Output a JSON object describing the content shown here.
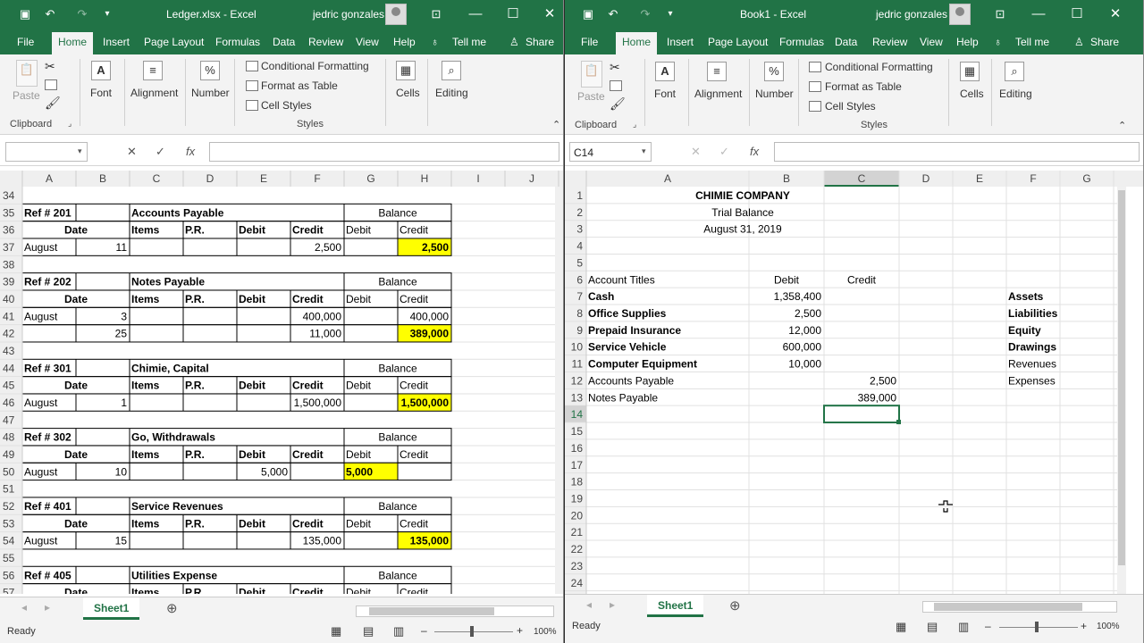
{
  "left": {
    "title": "Ledger.xlsx  -  Excel",
    "user": "jedric gonzales",
    "tabs": [
      "File",
      "Home",
      "Insert",
      "Page Layout",
      "Formulas",
      "Data",
      "Review",
      "View",
      "Help"
    ],
    "tell_me": "Tell me",
    "share": "Share",
    "ribbon": {
      "paste": "Paste",
      "clipboard": "Clipboard",
      "font": "Font",
      "alignment": "Alignment",
      "number": "Number",
      "cond_format": "Conditional Formatting",
      "format_table": "Format as Table",
      "cell_styles": "Cell Styles",
      "styles": "Styles",
      "cells": "Cells",
      "editing": "Editing"
    },
    "name_box": "",
    "columns": [
      "A",
      "B",
      "C",
      "D",
      "E",
      "F",
      "G",
      "H",
      "I",
      "J"
    ],
    "rows": [
      {
        "n": "34",
        "c": {}
      },
      {
        "n": "35",
        "c": {
          "A": "Ref # 201",
          "C": "Accounts Payable",
          "GH": "Balance"
        }
      },
      {
        "n": "36",
        "c": {
          "AB": "Date",
          "C": "Items",
          "D": "P.R.",
          "E": "Debit",
          "F": "Credit",
          "G": "Debit",
          "H": "Credit"
        }
      },
      {
        "n": "37",
        "c": {
          "A": "August",
          "B": "11",
          "F": "2,500",
          "H": "2,500"
        }
      },
      {
        "n": "38",
        "c": {}
      },
      {
        "n": "39",
        "c": {
          "A": "Ref # 202",
          "C": "Notes Payable",
          "GH": "Balance"
        }
      },
      {
        "n": "40",
        "c": {
          "AB": "Date",
          "C": "Items",
          "D": "P.R.",
          "E": "Debit",
          "F": "Credit",
          "G": "Debit",
          "H": "Credit"
        }
      },
      {
        "n": "41",
        "c": {
          "A": "August",
          "B": "3",
          "F": "400,000",
          "H": "400,000"
        }
      },
      {
        "n": "42",
        "c": {
          "B": "25",
          "F": "11,000",
          "H": "389,000"
        }
      },
      {
        "n": "43",
        "c": {}
      },
      {
        "n": "44",
        "c": {
          "A": "Ref # 301",
          "C": "Chimie, Capital",
          "GH": "Balance"
        }
      },
      {
        "n": "45",
        "c": {
          "AB": "Date",
          "C": "Items",
          "D": "P.R.",
          "E": "Debit",
          "F": "Credit",
          "G": "Debit",
          "H": "Credit"
        }
      },
      {
        "n": "46",
        "c": {
          "A": "August",
          "B": "1",
          "F": "1,500,000",
          "H": "1,500,000"
        }
      },
      {
        "n": "47",
        "c": {}
      },
      {
        "n": "48",
        "c": {
          "A": "Ref # 302",
          "C": "Go, Withdrawals",
          "GH": "Balance"
        }
      },
      {
        "n": "49",
        "c": {
          "AB": "Date",
          "C": "Items",
          "D": "P.R.",
          "E": "Debit",
          "F": "Credit",
          "G": "Debit",
          "H": "Credit"
        }
      },
      {
        "n": "50",
        "c": {
          "A": "August",
          "B": "10",
          "E": "5,000",
          "G": "5,000"
        }
      },
      {
        "n": "51",
        "c": {}
      },
      {
        "n": "52",
        "c": {
          "A": "Ref # 401",
          "C": "Service Revenues",
          "GH": "Balance"
        }
      },
      {
        "n": "53",
        "c": {
          "AB": "Date",
          "C": "Items",
          "D": "P.R.",
          "E": "Debit",
          "F": "Credit",
          "G": "Debit",
          "H": "Credit"
        }
      },
      {
        "n": "54",
        "c": {
          "A": "August",
          "B": "15",
          "F": "135,000",
          "H": "135,000"
        }
      },
      {
        "n": "55",
        "c": {}
      },
      {
        "n": "56",
        "c": {
          "A": "Ref # 405",
          "C": "Utilities Expense",
          "GH": "Balance"
        }
      },
      {
        "n": "57",
        "c": {
          "AB": "Date",
          "C": "Items",
          "D": "P.R.",
          "E": "Debit",
          "F": "Credit",
          "G": "Debit",
          "H": "Credit"
        }
      }
    ],
    "sheet": "Sheet1",
    "status": "Ready",
    "zoom": "100%"
  },
  "right": {
    "title": "Book1  -  Excel",
    "user": "jedric gonzales",
    "tabs": [
      "File",
      "Home",
      "Insert",
      "Page Layout",
      "Formulas",
      "Data",
      "Review",
      "View",
      "Help"
    ],
    "tell_me": "Tell me",
    "share": "Share",
    "ribbon": {
      "paste": "Paste",
      "clipboard": "Clipboard",
      "font": "Font",
      "alignment": "Alignment",
      "number": "Number",
      "cond_format": "Conditional Formatting",
      "format_table": "Format as Table",
      "cell_styles": "Cell Styles",
      "styles": "Styles",
      "cells": "Cells",
      "editing": "Editing"
    },
    "name_box": "C14",
    "columns": [
      "A",
      "B",
      "C",
      "D",
      "E",
      "F",
      "G"
    ],
    "rows": [
      {
        "n": "1",
        "c": {
          "ABC": "CHIMIE COMPANY"
        }
      },
      {
        "n": "2",
        "c": {
          "ABC": "Trial Balance"
        }
      },
      {
        "n": "3",
        "c": {
          "ABC": "August 31, 2019"
        }
      },
      {
        "n": "4",
        "c": {}
      },
      {
        "n": "5",
        "c": {}
      },
      {
        "n": "6",
        "c": {
          "A": "Account Titles",
          "B": "Debit",
          "C": "Credit"
        }
      },
      {
        "n": "7",
        "c": {
          "A": "Cash",
          "B": "1,358,400",
          "F": "Assets"
        }
      },
      {
        "n": "8",
        "c": {
          "A": "Office Supplies",
          "B": "2,500",
          "F": "Liabilities"
        }
      },
      {
        "n": "9",
        "c": {
          "A": "Prepaid Insurance",
          "B": "12,000",
          "F": "Equity"
        }
      },
      {
        "n": "10",
        "c": {
          "A": "Service Vehicle",
          "B": "600,000",
          "F": "Drawings"
        }
      },
      {
        "n": "11",
        "c": {
          "A": "Computer Equipment",
          "B": "10,000",
          "F": "Revenues"
        }
      },
      {
        "n": "12",
        "c": {
          "A": "Accounts Payable",
          "C": "2,500",
          "F": "Expenses"
        }
      },
      {
        "n": "13",
        "c": {
          "A": "Notes Payable",
          "C": "389,000"
        }
      },
      {
        "n": "14",
        "c": {}
      },
      {
        "n": "15",
        "c": {}
      },
      {
        "n": "16",
        "c": {}
      },
      {
        "n": "17",
        "c": {}
      },
      {
        "n": "18",
        "c": {}
      },
      {
        "n": "19",
        "c": {}
      },
      {
        "n": "20",
        "c": {}
      },
      {
        "n": "21",
        "c": {}
      },
      {
        "n": "22",
        "c": {}
      },
      {
        "n": "23",
        "c": {}
      },
      {
        "n": "24",
        "c": {}
      }
    ],
    "sheet": "Sheet1",
    "status": "Ready",
    "zoom": "100%"
  },
  "colors": {
    "excel_green": "#217346",
    "highlight": "#ffff00",
    "selection": "#217346"
  }
}
